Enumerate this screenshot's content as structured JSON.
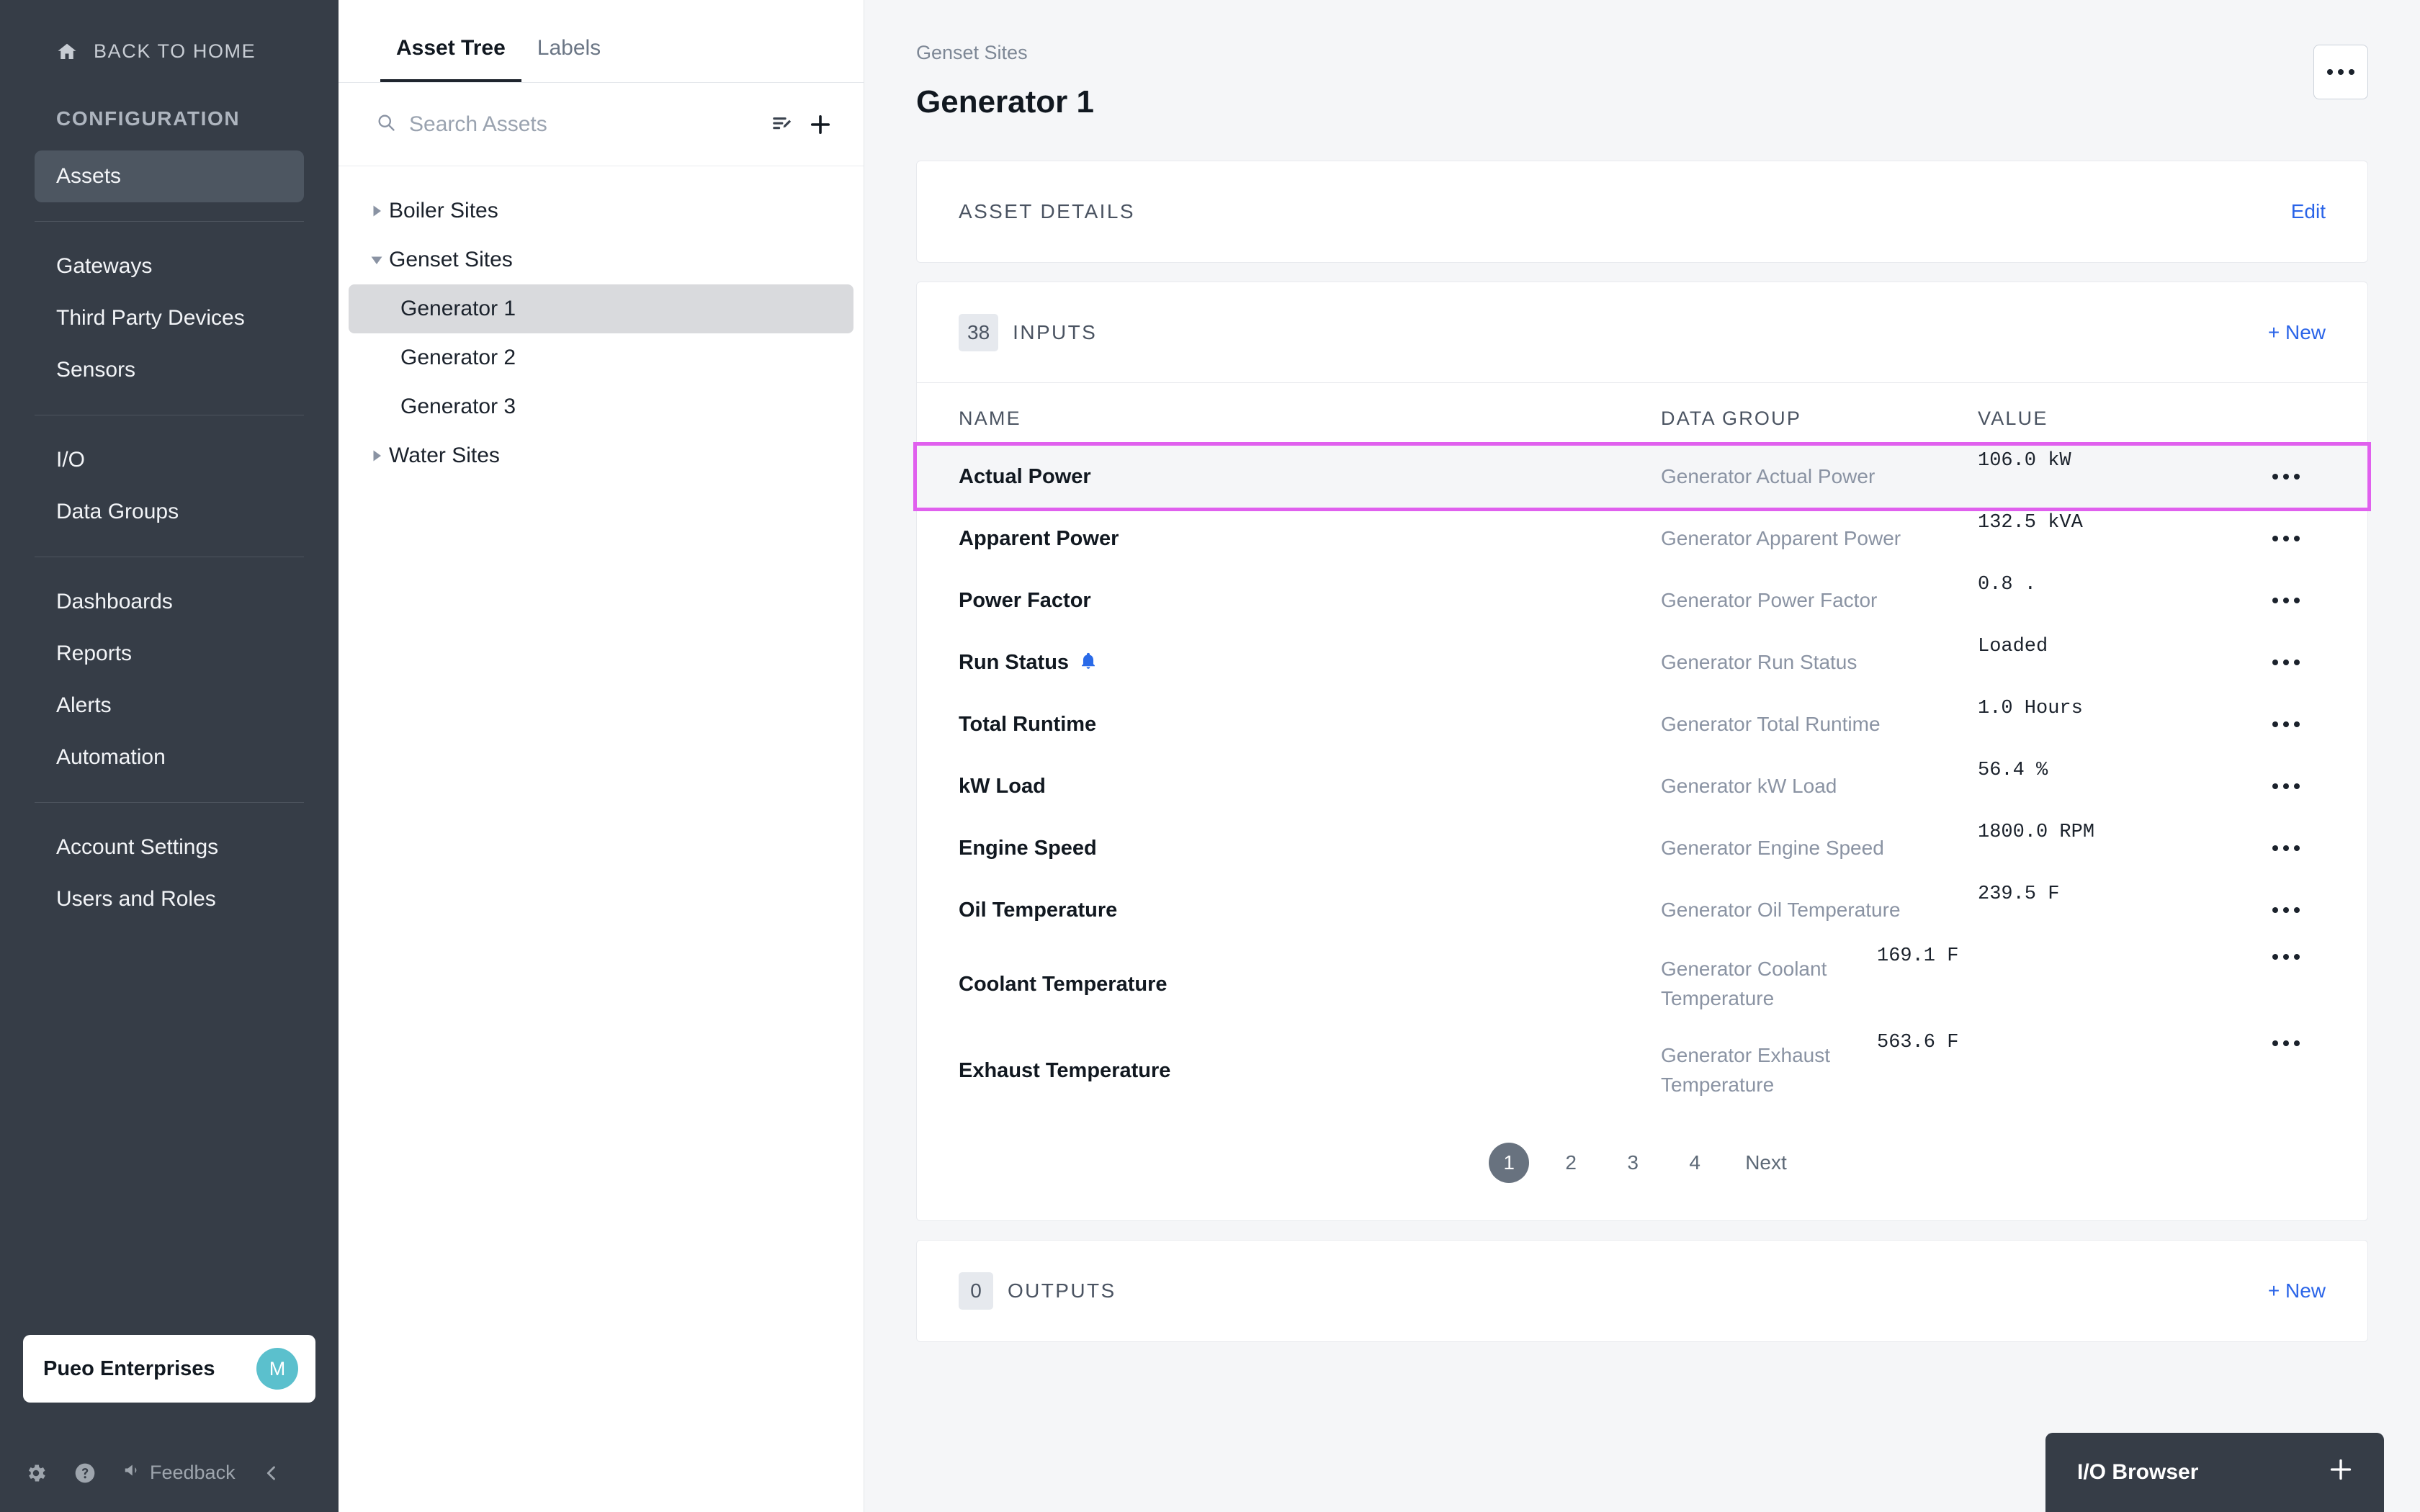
{
  "sidebar": {
    "back_home": "BACK TO HOME",
    "section_label": "CONFIGURATION",
    "groups": [
      {
        "items": [
          {
            "label": "Assets",
            "active": true
          }
        ]
      },
      {
        "items": [
          {
            "label": "Gateways"
          },
          {
            "label": "Third Party Devices"
          },
          {
            "label": "Sensors"
          }
        ]
      },
      {
        "items": [
          {
            "label": "I/O"
          },
          {
            "label": "Data Groups"
          }
        ]
      },
      {
        "items": [
          {
            "label": "Dashboards"
          },
          {
            "label": "Reports"
          },
          {
            "label": "Alerts"
          },
          {
            "label": "Automation"
          }
        ]
      },
      {
        "items": [
          {
            "label": "Account Settings"
          },
          {
            "label": "Users and Roles"
          }
        ]
      }
    ],
    "org_name": "Pueo Enterprises",
    "avatar_initial": "M",
    "footer": {
      "feedback_label": "Feedback",
      "gear_icon": "gear-icon",
      "help_icon": "question-circle-icon",
      "megaphone_icon": "megaphone-icon",
      "collapse_icon": "chevron-left-icon"
    },
    "bg_color": "#363d47"
  },
  "tree_panel": {
    "tabs": [
      {
        "label": "Asset Tree",
        "active": true
      },
      {
        "label": "Labels",
        "active": false
      }
    ],
    "search": {
      "placeholder": "Search Assets",
      "value": ""
    },
    "toolbar": {
      "edit_list_icon": "list-edit-icon",
      "add_icon": "plus-icon"
    },
    "tree": [
      {
        "label": "Boiler Sites",
        "level": 0,
        "expanded": false,
        "selected": false
      },
      {
        "label": "Genset Sites",
        "level": 0,
        "expanded": true,
        "selected": false
      },
      {
        "label": "Generator 1",
        "level": 1,
        "selected": true
      },
      {
        "label": "Generator 2",
        "level": 1,
        "selected": false
      },
      {
        "label": "Generator 3",
        "level": 1,
        "selected": false
      },
      {
        "label": "Water Sites",
        "level": 0,
        "expanded": false,
        "selected": false
      }
    ]
  },
  "main": {
    "breadcrumb": "Genset Sites",
    "title": "Generator 1",
    "kebab_icon": "more-horizontal-icon",
    "asset_details": {
      "title": "ASSET DETAILS",
      "edit_label": "Edit"
    },
    "inputs": {
      "count": "38",
      "title": "INPUTS",
      "new_label": "+ New",
      "columns": [
        "NAME",
        "DATA GROUP",
        "VALUE"
      ],
      "rows": [
        {
          "name": "Actual Power",
          "data_group": "Generator Actual Power",
          "value": "106.0  kW",
          "highlighted": true,
          "bell": false
        },
        {
          "name": "Apparent Power",
          "data_group": "Generator Apparent Power",
          "value": "132.5  kVA",
          "highlighted": false,
          "bell": false
        },
        {
          "name": "Power Factor",
          "data_group": "Generator Power Factor",
          "value": "0.8  .",
          "highlighted": false,
          "bell": false
        },
        {
          "name": "Run Status",
          "data_group": "Generator Run Status",
          "value": "Loaded",
          "highlighted": false,
          "bell": true
        },
        {
          "name": "Total Runtime",
          "data_group": "Generator Total Runtime",
          "value": "1.0  Hours",
          "highlighted": false,
          "bell": false
        },
        {
          "name": "kW Load",
          "data_group": "Generator kW Load",
          "value": "56.4  %",
          "highlighted": false,
          "bell": false
        },
        {
          "name": "Engine Speed",
          "data_group": "Generator Engine Speed",
          "value": "1800.0  RPM",
          "highlighted": false,
          "bell": false
        },
        {
          "name": "Oil Temperature",
          "data_group": "Generator Oil Temperature",
          "value": "239.5  F",
          "highlighted": false,
          "bell": false
        },
        {
          "name": "Coolant Temperature",
          "data_group": "Generator Coolant Temperature",
          "value": "169.1  F",
          "highlighted": false,
          "bell": false,
          "tall": true
        },
        {
          "name": "Exhaust Temperature",
          "data_group": "Generator Exhaust Temperature",
          "value": "563.6  F",
          "highlighted": false,
          "bell": false,
          "tall": true
        }
      ],
      "pagination": {
        "pages": [
          "1",
          "2",
          "3",
          "4"
        ],
        "current": "1",
        "next_label": "Next"
      }
    },
    "outputs": {
      "count": "0",
      "title": "OUTPUTS",
      "new_label": "+ New"
    },
    "io_browser": {
      "label": "I/O Browser",
      "expand_icon": "plus-icon"
    },
    "highlight_color": "#e060ee",
    "accent_color": "#2a64e8"
  }
}
